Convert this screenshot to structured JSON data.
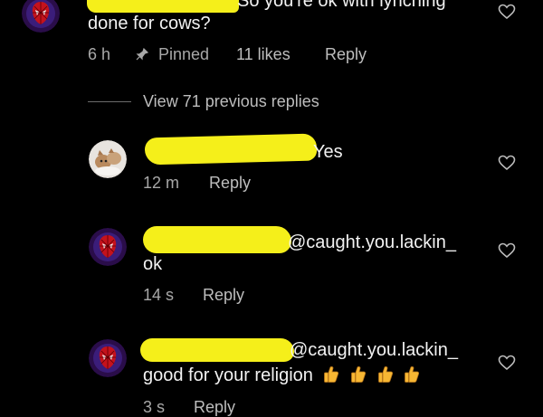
{
  "comments": [
    {
      "text_line1": "So you're ok with lynching",
      "text_line2": "done for cows?",
      "time": "6 h",
      "pinned_label": "Pinned",
      "likes": "11 likes",
      "reply_label": "Reply",
      "avatar": "spiderman-avatar"
    }
  ],
  "view_previous": "View 71 previous replies",
  "replies": [
    {
      "mention": "",
      "text": "Yes",
      "time": "12 m",
      "reply_label": "Reply",
      "avatar": "cat-avatar"
    },
    {
      "mention": "@caught.you.lackin_",
      "text": "ok",
      "time": "14 s",
      "reply_label": "Reply",
      "avatar": "spiderman-avatar"
    },
    {
      "mention": "@caught.you.lackin_",
      "text": "good for your religion",
      "emoji": "thumbs-up x4",
      "time": "3 s",
      "reply_label": "Reply",
      "avatar": "spiderman-avatar"
    }
  ],
  "colors": {
    "background": "#000000",
    "text": "#f2f2f2",
    "meta": "#a8a8a8",
    "redaction": "#f5ef1a"
  }
}
